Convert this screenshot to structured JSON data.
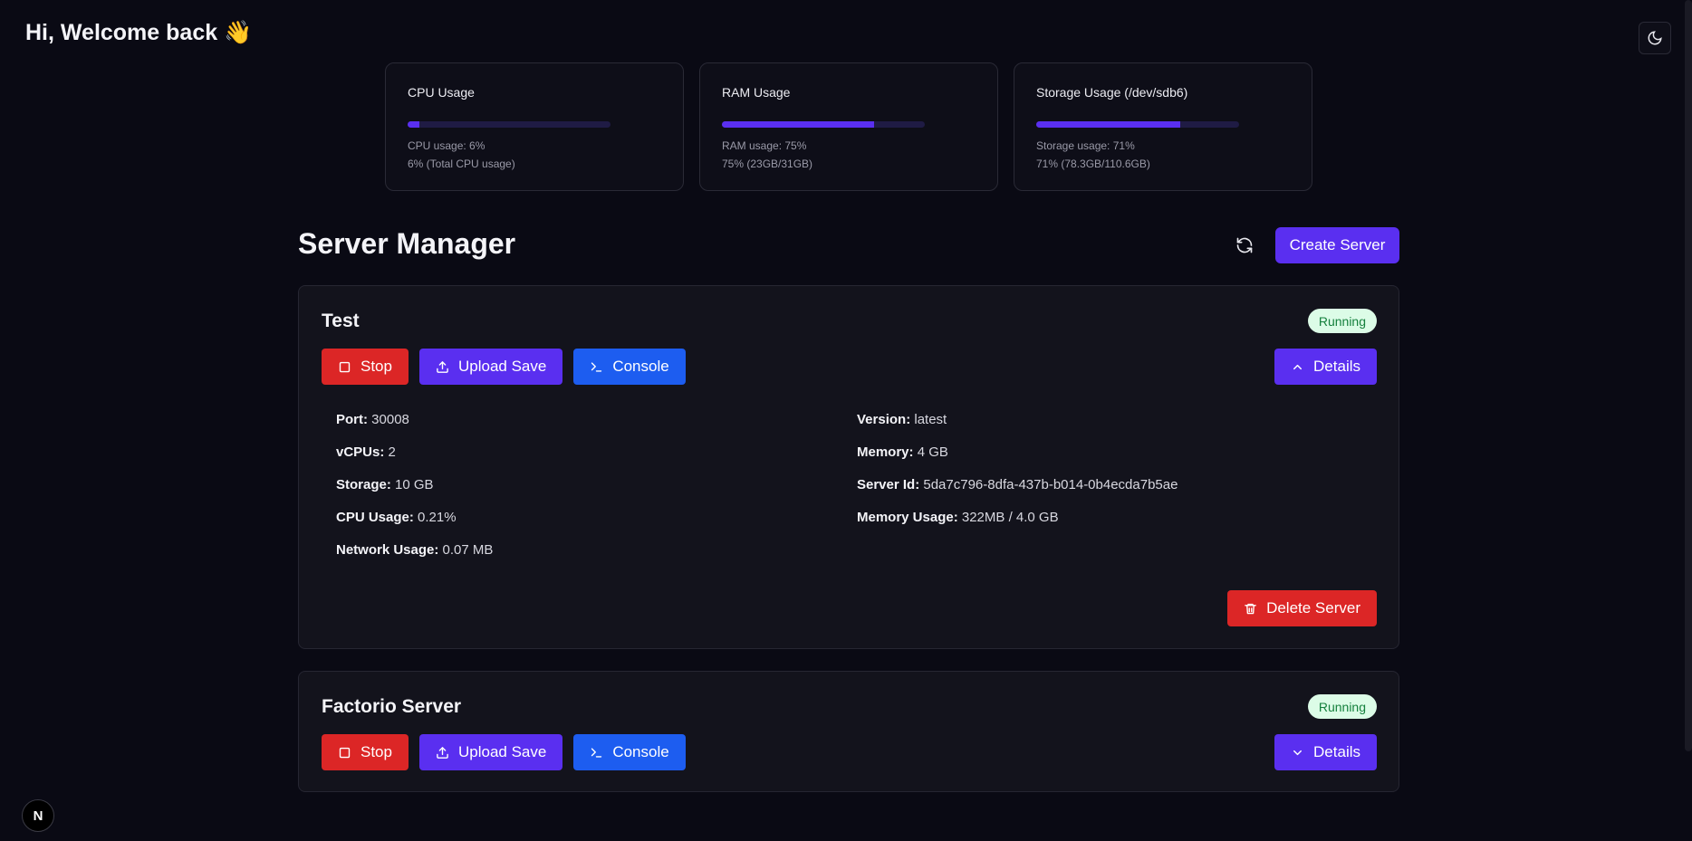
{
  "header": {
    "greeting": "Hi, Welcome back 👋",
    "theme_toggle_icon": "moon-icon"
  },
  "stats": [
    {
      "title": "CPU Usage",
      "percent": 6,
      "line1": "CPU usage: 6%",
      "line2": "6% (Total CPU usage)"
    },
    {
      "title": "RAM Usage",
      "percent": 75,
      "line1": "RAM usage: 75%",
      "line2": "75% (23GB/31GB)"
    },
    {
      "title": "Storage Usage (/dev/sdb6)",
      "percent": 71,
      "line1": "Storage usage: 71%",
      "line2": "71% (78.3GB/110.6GB)"
    }
  ],
  "manager": {
    "title": "Server Manager",
    "refresh_icon": "refresh-icon",
    "create_label": "Create Server"
  },
  "servers": [
    {
      "name": "Test",
      "status": "Running",
      "stop_label": "Stop",
      "upload_label": "Upload Save",
      "console_label": "Console",
      "details_label": "Details",
      "expanded": true,
      "details": {
        "port_label": "Port:",
        "port": "30008",
        "version_label": "Version:",
        "version": "latest",
        "vcpus_label": "vCPUs:",
        "vcpus": "2",
        "memory_label": "Memory:",
        "memory": "4 GB",
        "storage_label": "Storage:",
        "storage": "10 GB",
        "server_id_label": "Server Id:",
        "server_id": "5da7c796-8dfa-437b-b014-0b4ecda7b5ae",
        "cpu_usage_label": "CPU Usage:",
        "cpu_usage": "0.21%",
        "memory_usage_label": "Memory Usage:",
        "memory_usage": "322MB / 4.0 GB",
        "network_usage_label": "Network Usage:",
        "network_usage": "0.07 MB"
      },
      "delete_label": "Delete Server"
    },
    {
      "name": "Factorio Server",
      "status": "Running",
      "stop_label": "Stop",
      "upload_label": "Upload Save",
      "console_label": "Console",
      "details_label": "Details",
      "expanded": false
    }
  ],
  "footer": {
    "badge_letter": "N"
  },
  "colors": {
    "accent": "#5a2ff0",
    "danger": "#dc2626",
    "console": "#1d5df0",
    "status_bg": "#dcfce7",
    "status_fg": "#15803d"
  }
}
